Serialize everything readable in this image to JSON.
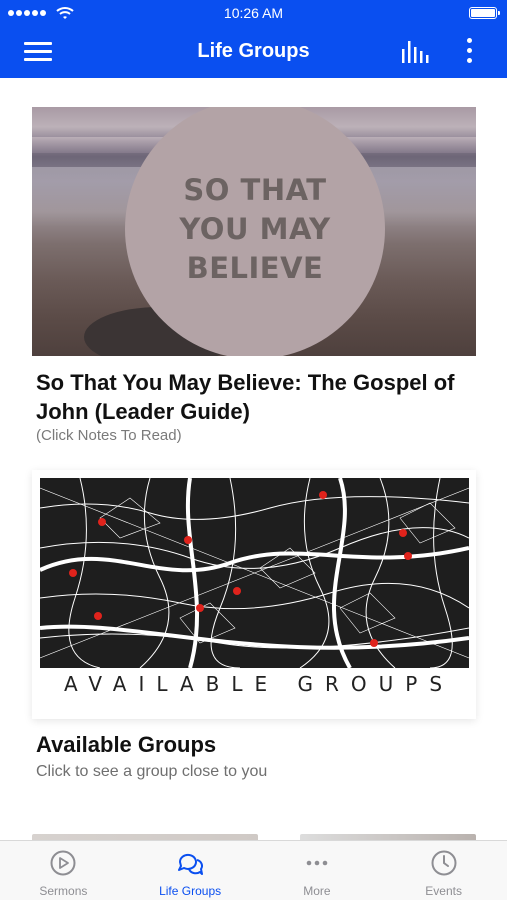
{
  "status_bar": {
    "time": "10:26 AM"
  },
  "nav": {
    "title": "Life Groups"
  },
  "cards": [
    {
      "image_text": [
        "SO THAT",
        "YOU MAY",
        "BELIEVE"
      ],
      "title": "So That You May Believe: The Gospel of John (Leader Guide)",
      "subtitle": "(Click Notes To Read)"
    },
    {
      "image_text": "AVAILABLE GROUPS",
      "title": "Available Groups",
      "subtitle": "Click to see a group close to you"
    }
  ],
  "tabs": [
    {
      "label": "Sermons",
      "icon": "play-circle-icon",
      "active": false
    },
    {
      "label": "Life Groups",
      "icon": "chat-bubbles-icon",
      "active": true
    },
    {
      "label": "More",
      "icon": "more-dots-icon",
      "active": false
    },
    {
      "label": "Events",
      "icon": "clock-icon",
      "active": false
    }
  ],
  "colors": {
    "brand": "#0a4ff0",
    "map_pin": "#e0231c",
    "tab_inactive": "#8e8e93"
  }
}
